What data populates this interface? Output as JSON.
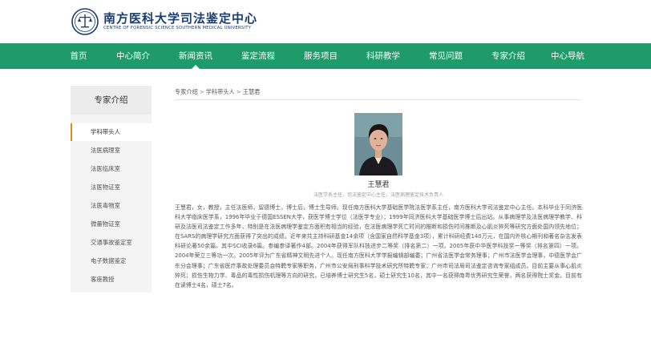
{
  "header": {
    "title": "南方医科大学司法鉴定中心",
    "subtitle": "CENTRE OF FORENSIC SCIENCE SOUTHERN MEDICAL UNIVERSITY",
    "logo_icon": "university-seal-icon"
  },
  "nav": {
    "items": [
      {
        "label": "首页"
      },
      {
        "label": "中心简介"
      },
      {
        "label": "新闻资讯"
      },
      {
        "label": "鉴定流程"
      },
      {
        "label": "服务项目"
      },
      {
        "label": "科研教学"
      },
      {
        "label": "常见问题"
      },
      {
        "label": "专家介绍"
      },
      {
        "label": "中心导航"
      }
    ],
    "active": "新闻资讯"
  },
  "sidebar": {
    "title": "专家介绍",
    "items": [
      {
        "label": "学科带头人"
      },
      {
        "label": "法医病理室"
      },
      {
        "label": "法医临床室"
      },
      {
        "label": "法医物证室"
      },
      {
        "label": "法医毒物室"
      },
      {
        "label": "微量物证室"
      },
      {
        "label": "交通事故鉴定室"
      },
      {
        "label": "电子数据鉴定"
      },
      {
        "label": "客座教授"
      }
    ],
    "active": "学科带头人"
  },
  "breadcrumb": {
    "items": [
      "专家介绍",
      "学科带头人",
      "王慧君"
    ],
    "separator": ">"
  },
  "profile": {
    "name": "王慧君",
    "titles": "法医学系主任，司法鉴定中心主任，法医病理鉴定技术负责人",
    "bio": "王慧君，女，教授，主任法医师，留德博士，博士后，博士生导师。现任南方医科大学基础医学院法医学系主任，南方医科大学司法鉴定中心主任。本科毕业于同济医科大学临床医学系，1996年毕业于德国ESSEN大学，获医学博士学位（法医学专业）；1999年同济医科大学基础医学博士后出站。从事病理学及法医病理学教学、科研及法医司法鉴定工作多年，特别是在法医病理学鉴定方面积有相当的经验，在法医病理学死亡时间的推断和损伤时间推断及心肌炎猝死等研究方面处国内领先地位；在SARS的病理学研究方面获得了突出的成绩。近年来共主持科研基金14余项（含国家自然科学基金3项），累计科研经费140万元，在国内外核心期刊和著名杂志发表科研论著50余篇。其中SCI收录6篇。参编参译著作4部。2004年获得军队科技进步二等奖（排名第二）一项。2005年获中华医学科技奖一等奖（排名第四）一项。2004年荣立三等功一次。2005年评为广东省精神文明先进个人。现任南方医科大学学报编辑部编委；广州省法医学会常务理事；广州市法医学会理事，中德医学会广东分会理事；广东省医疗事故处理委员会特聘专家等职务，广州市公安局刑事科学技术研究所特聘专家；广州市司法局司法鉴定咨询专家组成员。目前主要从事心肌炎猝死；损伤生物力学、毒品的毒性损伤机理等方向的研究，已培养博士研究生5名，硕士研究生10名，其中一名获得南粤优秀研究生荣誉，两名获得院士奖金。目前有在读博士4名，硕士7名。"
  },
  "colors": {
    "nav_bg": "#1e9a6b",
    "brand_text": "#1a3c6e",
    "active_marker": "#e08a1e"
  }
}
